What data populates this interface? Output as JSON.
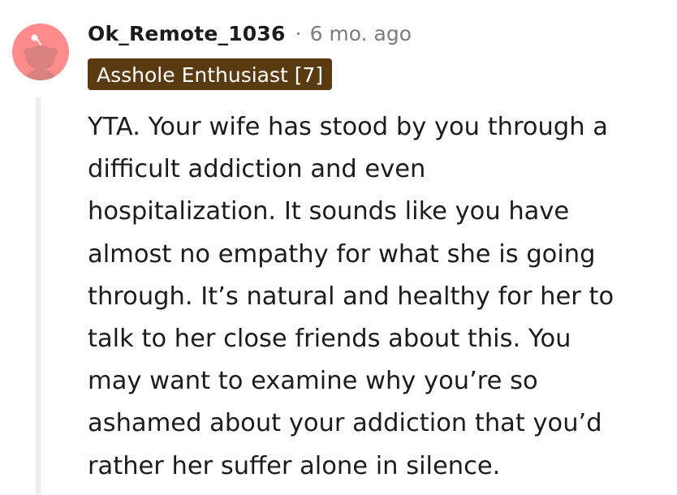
{
  "comment": {
    "avatar_icon": "reddit-snoo-avatar-icon",
    "avatar_color": "#ff8c8c",
    "username": "Ok_Remote_1036",
    "separator": "·",
    "timestamp": "6 mo. ago",
    "flair": {
      "text": "Asshole Enthusiast [7]",
      "background": "#5a3a10",
      "color": "#ffffff"
    },
    "body_lines": [
      "YTA. Your wife has stood by you through a",
      "difficult addiction and even",
      "hospitalization. It sounds like you have",
      "almost no empathy for what she is going",
      "through. It’s natural and healthy for her to",
      "talk to her close friends about this. You",
      "may want to examine why you’re so",
      "ashamed about your addiction that you’d",
      "rather her suffer alone in silence."
    ]
  }
}
